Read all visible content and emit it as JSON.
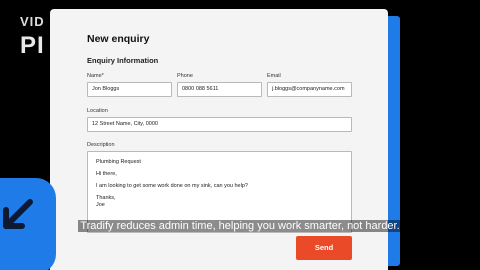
{
  "background": {
    "title_line1": "VID",
    "title_line2": "PI"
  },
  "colors": {
    "accent_blue": "#1e7be8",
    "send_orange": "#ea4a27"
  },
  "form": {
    "title": "New enquiry",
    "section_title": "Enquiry Information",
    "name": {
      "label": "Name*",
      "value": "Jon Bloggs"
    },
    "phone": {
      "label": "Phone",
      "value": "0800 088 5611"
    },
    "email": {
      "label": "Email",
      "value": "j.bloggs@companyname.com"
    },
    "location": {
      "label": "Location",
      "value": "12 Street Name, City, 0000"
    },
    "description": {
      "label": "Description",
      "lines": [
        "Plumbing Request",
        "Hi there,",
        "I am looking to get some work done on my sink, can you help?",
        "Thanks,",
        "Joe"
      ]
    },
    "send_label": "Send"
  },
  "caption": "Tradify reduces admin time, helping you work smarter, not harder.",
  "icons": {
    "badge": "arrow-down-left-icon"
  }
}
